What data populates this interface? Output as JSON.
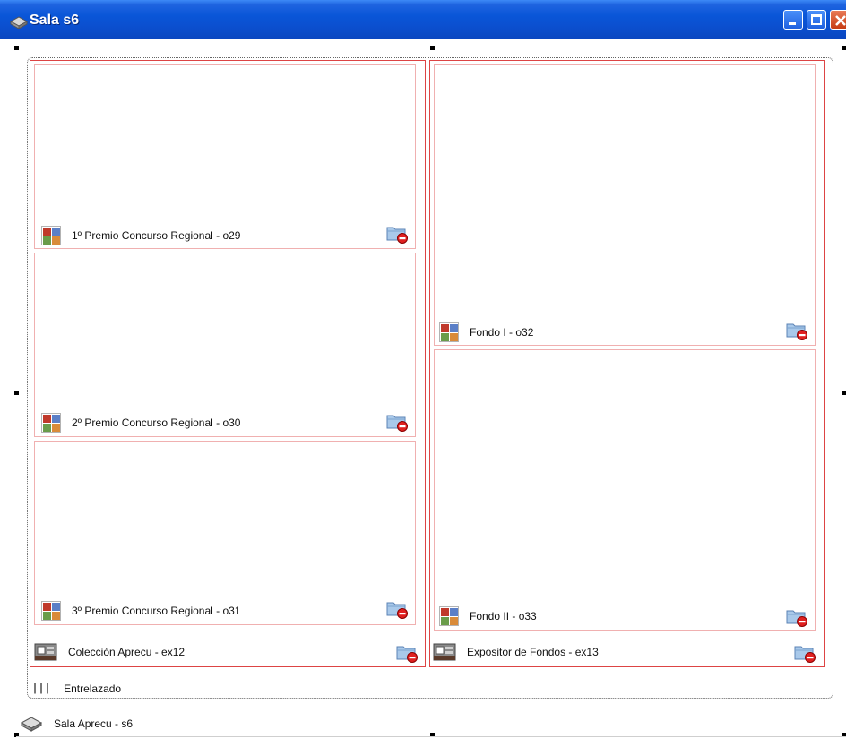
{
  "window": {
    "title": "Sala s6",
    "controls": [
      "minimize",
      "maximize",
      "close"
    ]
  },
  "colors": {
    "exhibitor_border": "#dd4444",
    "artwork_border": "#f0b0b0",
    "titlebar": "#0a56d8"
  },
  "exhibitors": [
    {
      "label": "Colección Aprecu - ex12",
      "icon": "exhibitor-icon",
      "action_icon": "folder-remove-icon",
      "artworks": [
        {
          "label": "1º Premio Concurso Regional - o29",
          "icon": "artwork-icon",
          "action_icon": "folder-remove-icon"
        },
        {
          "label": "2º Premio Concurso Regional - o30",
          "icon": "artwork-icon",
          "action_icon": "folder-remove-icon"
        },
        {
          "label": "3º Premio Concurso Regional - o31",
          "icon": "artwork-icon",
          "action_icon": "folder-remove-icon"
        }
      ]
    },
    {
      "label": "Expositor de Fondos - ex13",
      "icon": "exhibitor-icon",
      "action_icon": "folder-remove-icon",
      "artworks": [
        {
          "label": "Fondo I - o32",
          "icon": "artwork-icon",
          "action_icon": "folder-remove-icon"
        },
        {
          "label": "Fondo II - o33",
          "icon": "artwork-icon",
          "action_icon": "folder-remove-icon"
        }
      ]
    }
  ],
  "layout_mode": {
    "label": "Entrelazado",
    "icon": "layout-bars-icon"
  },
  "room": {
    "label": "Sala Aprecu  - s6",
    "icon": "room-icon"
  }
}
